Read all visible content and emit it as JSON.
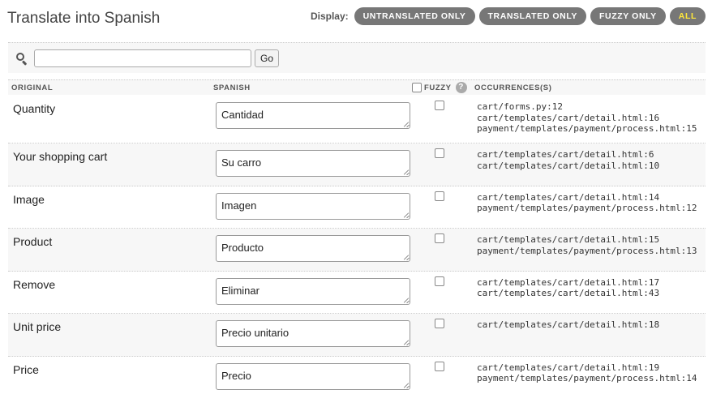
{
  "page": {
    "title": "Translate into Spanish"
  },
  "display": {
    "label": "Display:",
    "filters": [
      {
        "label": "UNTRANSLATED ONLY",
        "active": false
      },
      {
        "label": "TRANSLATED ONLY",
        "active": false
      },
      {
        "label": "FUZZY ONLY",
        "active": false
      },
      {
        "label": "ALL",
        "active": true
      }
    ]
  },
  "search": {
    "value": "",
    "go_label": "Go"
  },
  "columns": {
    "original": "ORIGINAL",
    "spanish": "SPANISH",
    "fuzzy": "FUZZY",
    "help": "?",
    "occurrences": "OCCURRENCES(S)"
  },
  "rows": [
    {
      "original": "Quantity",
      "translation": "Cantidad",
      "fuzzy": false,
      "occurrences": [
        "cart/forms.py:12",
        "cart/templates/cart/detail.html:16",
        "payment/templates/payment/process.html:15"
      ]
    },
    {
      "original": "Your shopping cart",
      "translation": "Su carro",
      "fuzzy": false,
      "occurrences": [
        "cart/templates/cart/detail.html:6",
        "cart/templates/cart/detail.html:10"
      ]
    },
    {
      "original": "Image",
      "translation": "Imagen",
      "fuzzy": false,
      "occurrences": [
        "cart/templates/cart/detail.html:14",
        "payment/templates/payment/process.html:12"
      ]
    },
    {
      "original": "Product",
      "translation": "Producto",
      "fuzzy": false,
      "occurrences": [
        "cart/templates/cart/detail.html:15",
        "payment/templates/payment/process.html:13"
      ]
    },
    {
      "original": "Remove",
      "translation": "Eliminar",
      "fuzzy": false,
      "occurrences": [
        "cart/templates/cart/detail.html:17",
        "cart/templates/cart/detail.html:43"
      ]
    },
    {
      "original": "Unit price",
      "translation": "Precio unitario",
      "fuzzy": false,
      "occurrences": [
        "cart/templates/cart/detail.html:18"
      ]
    },
    {
      "original": "Price",
      "translation": "Precio",
      "fuzzy": false,
      "occurrences": [
        "cart/templates/cart/detail.html:19",
        "payment/templates/payment/process.html:14"
      ]
    }
  ]
}
